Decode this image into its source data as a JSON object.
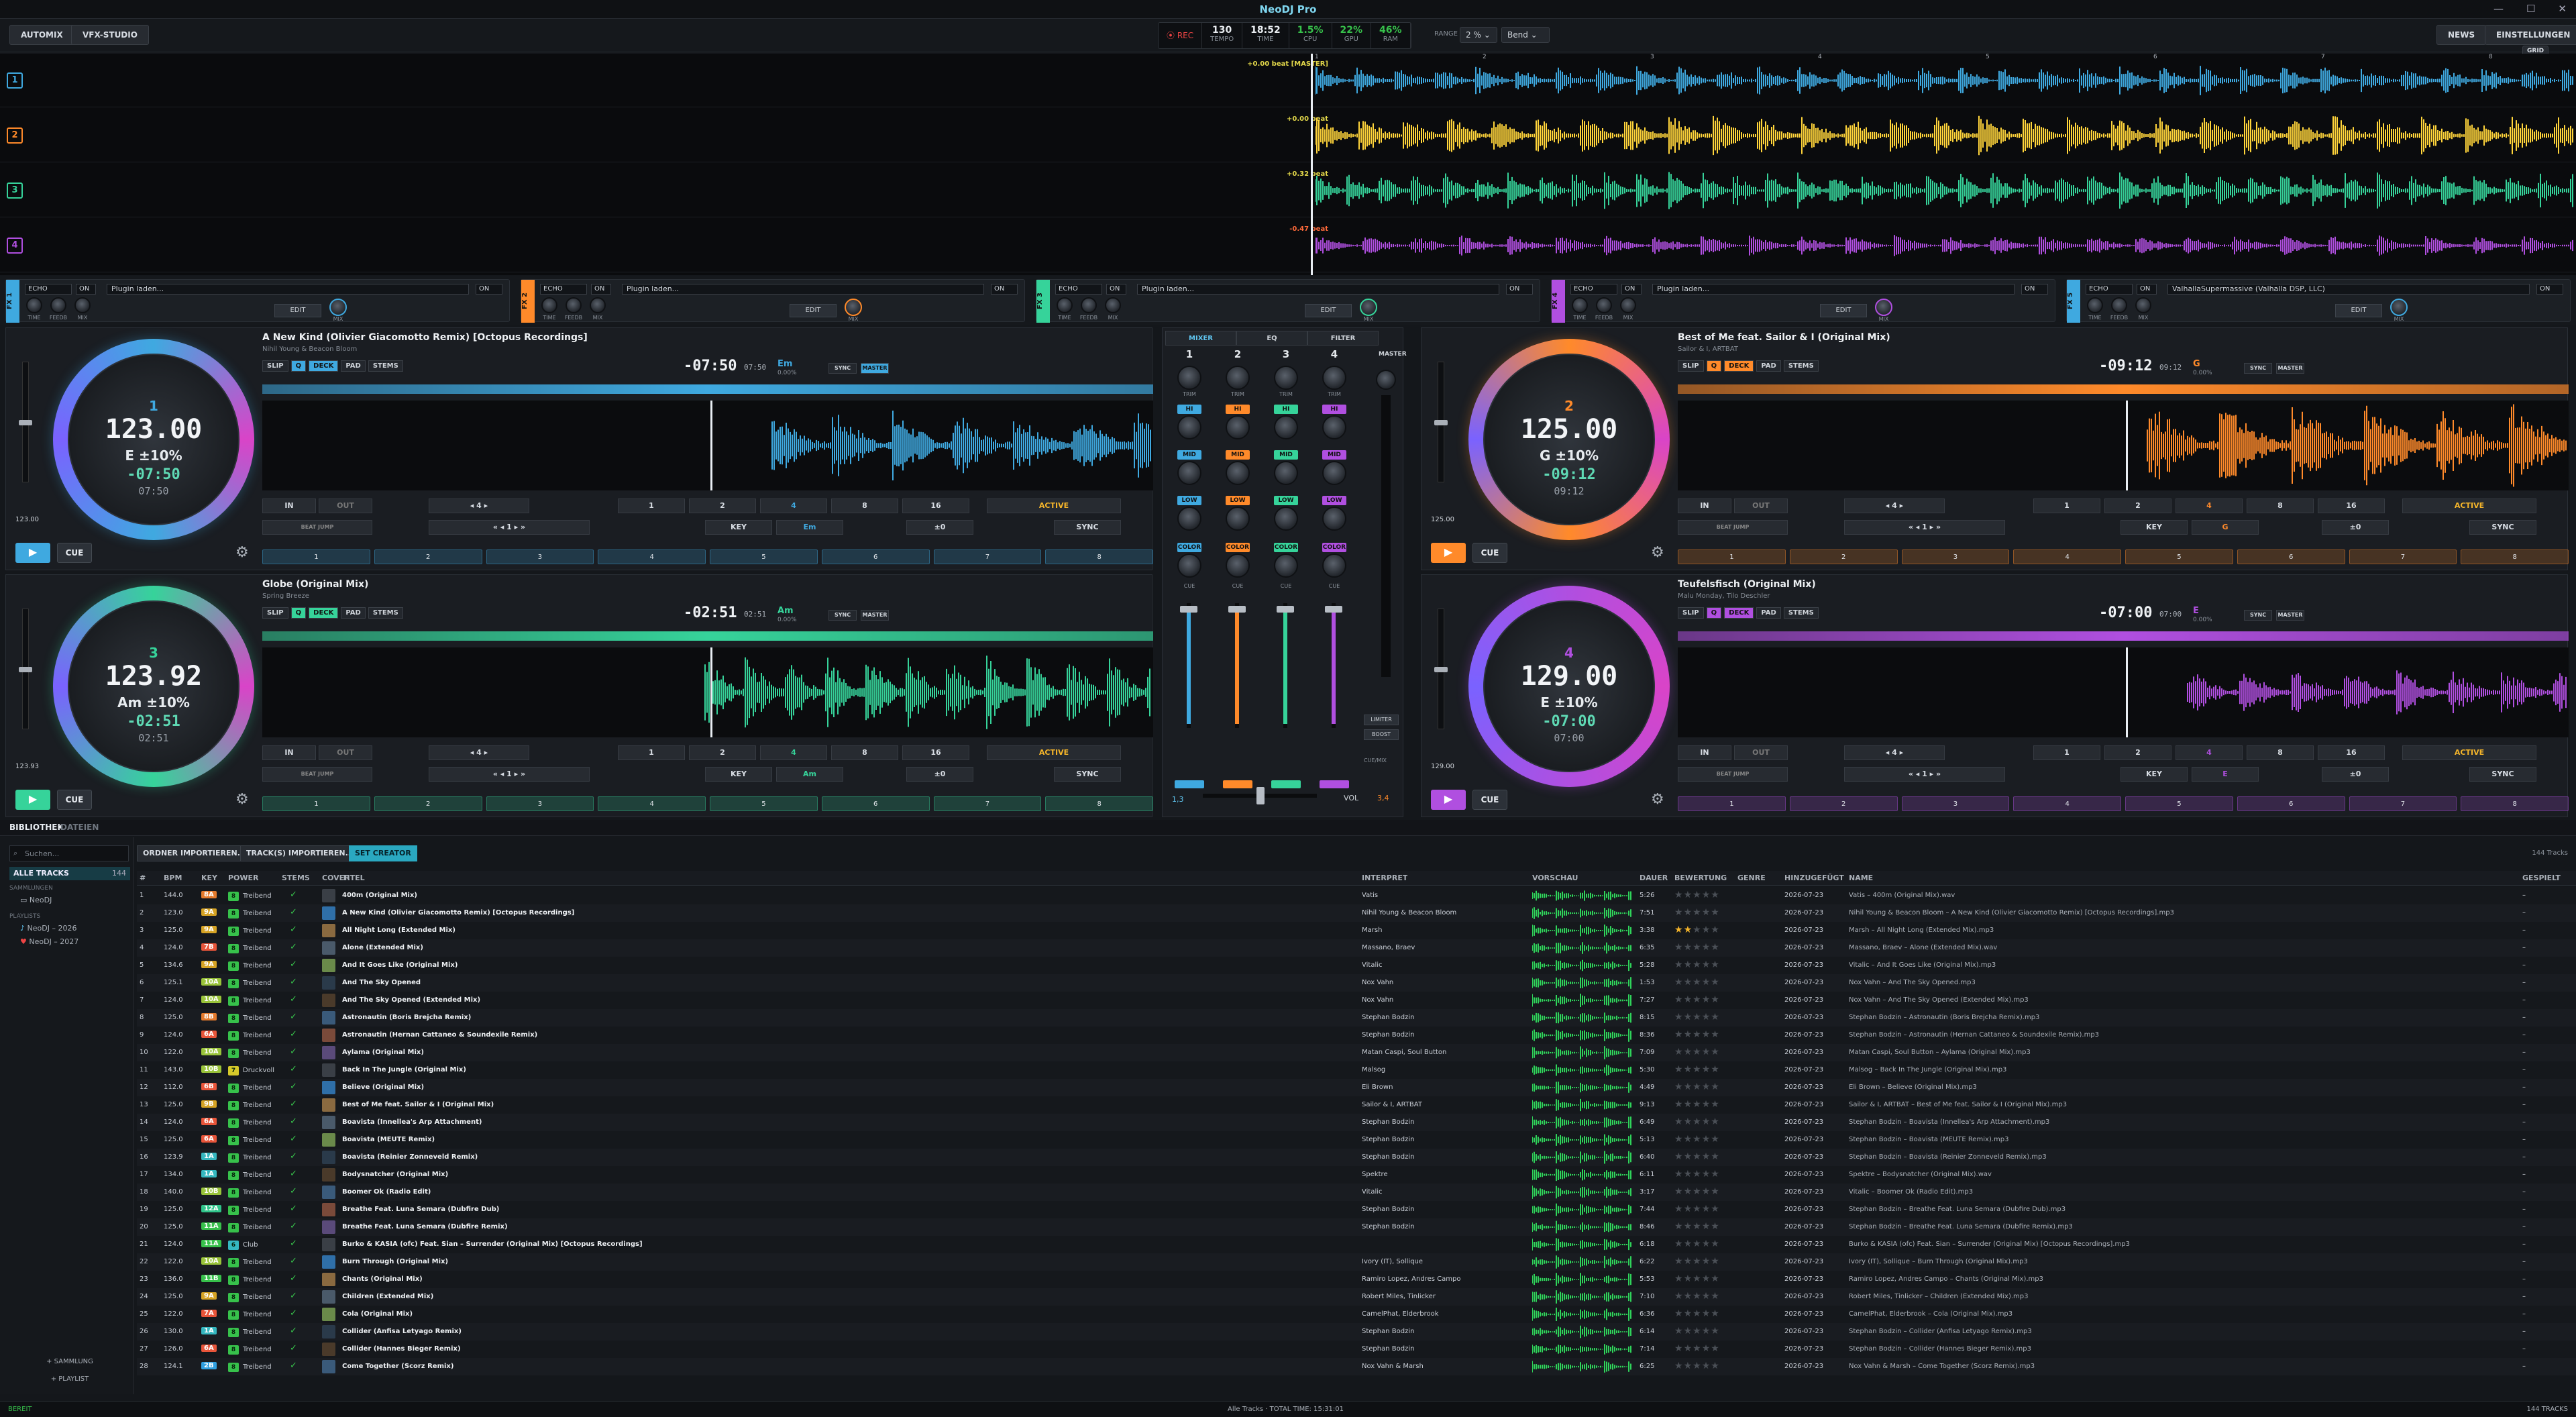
{
  "app": {
    "title": "NeoDJ Pro"
  },
  "toolbar": {
    "automix": "AUTOMIX",
    "vfx": "VFX-STUDIO",
    "rec": "REC",
    "counters": [
      {
        "value": "130",
        "label": "TEMPO"
      },
      {
        "value": "18:52",
        "label": "TIME"
      },
      {
        "value": "1.5%",
        "label": "CPU"
      },
      {
        "value": "22%",
        "label": "GPU"
      },
      {
        "value": "46%",
        "label": "RAM"
      }
    ],
    "range_label": "RANGE",
    "range_value": "2 %",
    "bend_value": "Bend",
    "news": "NEWS",
    "settings": "EINSTELLUNGEN",
    "grid": "GRID"
  },
  "overview": {
    "rows": [
      {
        "num": "1",
        "label": "+0.00 beat [MASTER]",
        "color": "#3fa9e0"
      },
      {
        "num": "2",
        "label": "+0.00 beat",
        "color": "#ff8a2a"
      },
      {
        "num": "3",
        "label": "+0.32 beat",
        "color": "#36d39a"
      },
      {
        "num": "4",
        "label": "-0.47 beat",
        "color": "#b04fe0"
      }
    ],
    "timeline": [
      "1",
      "2",
      "3",
      "4",
      "5",
      "6",
      "7",
      "8"
    ]
  },
  "fx": [
    {
      "tag": "FX 1",
      "color": "#3fa9e0",
      "effect": "ECHO",
      "plugin": "Plugin laden...",
      "edit": "EDIT",
      "knobs": [
        "TIME",
        "FEEDB",
        "MIX"
      ],
      "mix": "MIX",
      "onoff": "ON"
    },
    {
      "tag": "FX 2",
      "color": "#ff8a2a",
      "effect": "ECHO",
      "plugin": "Plugin laden...",
      "edit": "EDIT",
      "knobs": [
        "TIME",
        "FEEDB",
        "MIX"
      ],
      "mix": "MIX",
      "onoff": "ON"
    },
    {
      "tag": "FX 3",
      "color": "#36d39a",
      "effect": "ECHO",
      "plugin": "Plugin laden...",
      "edit": "EDIT",
      "knobs": [
        "TIME",
        "FEEDB",
        "MIX"
      ],
      "mix": "MIX",
      "onoff": "ON"
    },
    {
      "tag": "FX 4",
      "color": "#b04fe0",
      "effect": "ECHO",
      "plugin": "Plugin laden...",
      "edit": "EDIT",
      "knobs": [
        "TIME",
        "FEEDB",
        "MIX"
      ],
      "mix": "MIX",
      "onoff": "ON"
    },
    {
      "tag": "FX 5",
      "color": "#3fa9e0",
      "effect": "ECHO",
      "plugin": "ValhallaSupermassive (Valhalla DSP, LLC)",
      "edit": "EDIT",
      "knobs": [
        "TIME",
        "FEEDB",
        "MIX"
      ],
      "mix": "MIX",
      "onoff": "ON"
    }
  ],
  "decks": [
    {
      "num": "1",
      "color": "#3fa9e0",
      "title": "A New Kind (Olivier Giacomotto Remix) [Octopus Recordings]",
      "artist": "Nihil Young & Beacon Bloom",
      "bpm": "123.00",
      "key": "E",
      "pitch": "±10%",
      "remain": "-07:50",
      "elapsed": "07:50",
      "time_big": "-07:50",
      "time_total": "07:50",
      "key_disp": "Em",
      "key_sub": "0.00%",
      "pitch_value": "123.00",
      "sync": "SYNC",
      "master": "MASTER",
      "in": "IN",
      "out": "OUT",
      "loop": "4",
      "loop_sizes": [
        "1",
        "2",
        "4",
        "8",
        "16"
      ],
      "active": "ACTIVE",
      "beatjump": "BEAT JUMP",
      "jump": "1",
      "keybtn": "KEY",
      "keyval": "Em",
      "pitchval": "±0",
      "syncbtn": "SYNC",
      "pads": [
        "1",
        "2",
        "3",
        "4",
        "5",
        "6",
        "7",
        "8"
      ],
      "play": "▶",
      "cue": "CUE"
    },
    {
      "num": "2",
      "color": "#ff8a2a",
      "title": "Best of Me feat. Sailor & I (Original Mix)",
      "artist": "Sailor & I, ARTBAT",
      "bpm": "125.00",
      "key": "G",
      "pitch": "±10%",
      "remain": "-09:12",
      "elapsed": "09:12",
      "time_big": "-09:12",
      "time_total": "09:12",
      "key_disp": "G",
      "key_sub": "0.00%",
      "pitch_value": "125.00",
      "sync": "SYNC",
      "master": "MASTER",
      "in": "IN",
      "out": "OUT",
      "loop": "4",
      "loop_sizes": [
        "1",
        "2",
        "4",
        "8",
        "16"
      ],
      "active": "ACTIVE",
      "beatjump": "BEAT JUMP",
      "jump": "1",
      "keybtn": "KEY",
      "keyval": "G",
      "pitchval": "±0",
      "syncbtn": "SYNC",
      "pads": [
        "1",
        "2",
        "3",
        "4",
        "5",
        "6",
        "7",
        "8"
      ],
      "play": "▶",
      "cue": "CUE"
    },
    {
      "num": "3",
      "color": "#36d39a",
      "title": "Globe (Original Mix)",
      "artist": "Spring Breeze",
      "bpm": "123.92",
      "key": "Am",
      "pitch": "±10%",
      "remain": "-02:51",
      "elapsed": "02:51",
      "time_big": "-02:51",
      "time_total": "02:51",
      "key_disp": "Am",
      "key_sub": "0.00%",
      "pitch_value": "123.93",
      "sync": "SYNC",
      "master": "MASTER",
      "in": "IN",
      "out": "OUT",
      "loop": "4",
      "loop_sizes": [
        "1",
        "2",
        "4",
        "8",
        "16"
      ],
      "active": "ACTIVE",
      "beatjump": "BEAT JUMP",
      "jump": "1",
      "keybtn": "KEY",
      "keyval": "Am",
      "pitchval": "±0",
      "syncbtn": "SYNC",
      "pads": [
        "1",
        "2",
        "3",
        "4",
        "5",
        "6",
        "7",
        "8"
      ],
      "play": "▶",
      "cue": "CUE"
    },
    {
      "num": "4",
      "color": "#b04fe0",
      "title": "Teufelsfisch (Original Mix)",
      "artist": "Malu Monday, Tilo Deschler",
      "bpm": "129.00",
      "key": "E",
      "pitch": "±10%",
      "remain": "-07:00",
      "elapsed": "07:00",
      "time_big": "-07:00",
      "time_total": "07:00",
      "key_disp": "E",
      "key_sub": "0.00%",
      "pitch_value": "129.00",
      "sync": "SYNC",
      "master": "MASTER",
      "in": "IN",
      "out": "OUT",
      "loop": "4",
      "loop_sizes": [
        "1",
        "2",
        "4",
        "8",
        "16"
      ],
      "active": "ACTIVE",
      "beatjump": "BEAT JUMP",
      "jump": "1",
      "keybtn": "KEY",
      "keyval": "E",
      "pitchval": "±0",
      "syncbtn": "SYNC",
      "pads": [
        "1",
        "2",
        "3",
        "4",
        "5",
        "6",
        "7",
        "8"
      ],
      "play": "▶",
      "cue": "CUE"
    }
  ],
  "deck_modes": [
    "SLIP",
    "Q",
    "DECK",
    "PAD",
    "STEMS"
  ],
  "mixer": {
    "tabs": [
      "MIXER",
      "EQ",
      "FILTER"
    ],
    "master": "MASTER",
    "channels": [
      "1",
      "2",
      "3",
      "4"
    ],
    "trim": "TRIM",
    "eq": [
      "HI",
      "MID",
      "LOW"
    ],
    "color": "COLOR",
    "cue": "CUE",
    "limiter": "LIMITER",
    "boost": "BOOST",
    "xfader_value": "1,3",
    "vol_label": "VOL",
    "vol_value": "3,4",
    "headphones": "CUE/MIX"
  },
  "library": {
    "tabs": [
      "BIBLIOTHEK",
      "DATEIEN"
    ],
    "search_placeholder": "Suchen...",
    "sidebar": [
      "ALLE TRACKS",
      "SAMMLUNGEN",
      "NeoDJ",
      "PLAYLISTS",
      "NeoDJ – 2026",
      "NeoDJ – 2027"
    ],
    "all_count": "144",
    "add_collection": "+ SAMMLUNG",
    "add_playlist": "+ PLAYLIST",
    "buttons": [
      "ORDNER IMPORTIEREN...",
      "TRACK(S) IMPORTIEREN...",
      "SET CREATOR"
    ],
    "count": "144 Tracks",
    "columns": [
      "#",
      "BPM",
      "KEY",
      "POWER",
      "STEMS",
      "COVER",
      "TITEL",
      "INTERPRET",
      "VORSCHAU",
      "DAUER",
      "BEWERTUNG",
      "GENRE",
      "HINZUGEFÜGT",
      "NAME",
      "GESPIELT"
    ],
    "rows": [
      {
        "n": "1",
        "bpm": "144.0",
        "key": "8A",
        "power": "8",
        "genre_p": "Treibend",
        "title": "400m (Original Mix)",
        "artist": "Vatis",
        "dur": "5:26",
        "stars": 0,
        "added": "2026-07-23",
        "name": "Vatis – 400m (Original Mix).wav",
        "played": "–"
      },
      {
        "n": "2",
        "bpm": "123.0",
        "key": "9A",
        "power": "8",
        "genre_p": "Treibend",
        "title": "A New Kind (Olivier Giacomotto Remix) [Octopus Recordings]",
        "artist": "Nihil Young & Beacon Bloom",
        "dur": "7:51",
        "stars": 0,
        "added": "2026-07-23",
        "name": "Nihil Young & Beacon Bloom – A New Kind (Olivier Giacomotto Remix) [Octopus Recordings].mp3",
        "played": "–"
      },
      {
        "n": "3",
        "bpm": "125.0",
        "key": "9A",
        "power": "8",
        "genre_p": "Treibend",
        "title": "All Night Long (Extended Mix)",
        "artist": "Marsh",
        "dur": "3:38",
        "stars": 2,
        "added": "2026-07-23",
        "name": "Marsh – All Night Long (Extended Mix).mp3",
        "played": "–"
      },
      {
        "n": "4",
        "bpm": "124.0",
        "key": "7B",
        "power": "8",
        "genre_p": "Treibend",
        "title": "Alone (Extended Mix)",
        "artist": "Massano, Braev",
        "dur": "6:35",
        "stars": 0,
        "added": "2026-07-23",
        "name": "Massano, Braev – Alone (Extended Mix).wav",
        "played": "–"
      },
      {
        "n": "5",
        "bpm": "134.6",
        "key": "9A",
        "power": "8",
        "genre_p": "Treibend",
        "title": "And It Goes Like (Original Mix)",
        "artist": "Vitalic",
        "dur": "5:28",
        "stars": 0,
        "added": "2026-07-23",
        "name": "Vitalic – And It Goes Like (Original Mix).mp3",
        "played": "–"
      },
      {
        "n": "6",
        "bpm": "125.1",
        "key": "10A",
        "power": "8",
        "genre_p": "Treibend",
        "title": "And The Sky Opened",
        "artist": "Nox Vahn",
        "dur": "1:53",
        "stars": 0,
        "added": "2026-07-23",
        "name": "Nox Vahn – And The Sky Opened.mp3",
        "played": "–"
      },
      {
        "n": "7",
        "bpm": "124.0",
        "key": "10A",
        "power": "8",
        "genre_p": "Treibend",
        "title": "And The Sky Opened (Extended Mix)",
        "artist": "Nox Vahn",
        "dur": "7:27",
        "stars": 0,
        "added": "2026-07-23",
        "name": "Nox Vahn – And The Sky Opened (Extended Mix).mp3",
        "played": "–"
      },
      {
        "n": "8",
        "bpm": "125.0",
        "key": "8B",
        "power": "8",
        "genre_p": "Treibend",
        "title": "Astronautin (Boris Brejcha Remix)",
        "artist": "Stephan Bodzin",
        "dur": "8:15",
        "stars": 0,
        "added": "2026-07-23",
        "name": "Stephan Bodzin – Astronautin (Boris Brejcha Remix).mp3",
        "played": "–"
      },
      {
        "n": "9",
        "bpm": "124.0",
        "key": "6A",
        "power": "8",
        "genre_p": "Treibend",
        "title": "Astronautin (Hernan Cattaneo & Soundexile Remix)",
        "artist": "Stephan Bodzin",
        "dur": "8:36",
        "stars": 0,
        "added": "2026-07-23",
        "name": "Stephan Bodzin – Astronautin (Hernan Cattaneo & Soundexile Remix).mp3",
        "played": "–"
      },
      {
        "n": "10",
        "bpm": "122.0",
        "key": "10A",
        "power": "8",
        "genre_p": "Treibend",
        "title": "Aylama (Original Mix)",
        "artist": "Matan Caspi, Soul Button",
        "dur": "7:09",
        "stars": 0,
        "added": "2026-07-23",
        "name": "Matan Caspi, Soul Button – Aylama (Original Mix).mp3",
        "played": "–"
      },
      {
        "n": "11",
        "bpm": "143.0",
        "key": "10B",
        "power": "7",
        "genre_p": "Druckvoll",
        "title": "Back In The Jungle (Original Mix)",
        "artist": "Malsog",
        "dur": "5:30",
        "stars": 0,
        "added": "2026-07-23",
        "name": "Malsog – Back In The Jungle (Original Mix).mp3",
        "played": "–"
      },
      {
        "n": "12",
        "bpm": "112.0",
        "key": "6B",
        "power": "8",
        "genre_p": "Treibend",
        "title": "Believe (Original Mix)",
        "artist": "Eli Brown",
        "dur": "4:49",
        "stars": 0,
        "added": "2026-07-23",
        "name": "Eli Brown – Believe (Original Mix).mp3",
        "played": "–"
      },
      {
        "n": "13",
        "bpm": "125.0",
        "key": "9B",
        "power": "8",
        "genre_p": "Treibend",
        "title": "Best of Me feat. Sailor & I (Original Mix)",
        "artist": "Sailor & I, ARTBAT",
        "dur": "9:13",
        "stars": 0,
        "added": "2026-07-23",
        "name": "Sailor & I, ARTBAT – Best of Me feat. Sailor & I (Original Mix).mp3",
        "played": "–"
      },
      {
        "n": "14",
        "bpm": "124.0",
        "key": "6A",
        "power": "8",
        "genre_p": "Treibend",
        "title": "Boavista (Innellea's Arp Attachment)",
        "artist": "Stephan Bodzin",
        "dur": "6:49",
        "stars": 0,
        "added": "2026-07-23",
        "name": "Stephan Bodzin – Boavista (Innellea's Arp Attachment).mp3",
        "played": "–"
      },
      {
        "n": "15",
        "bpm": "125.0",
        "key": "6A",
        "power": "8",
        "genre_p": "Treibend",
        "title": "Boavista (MEUTE Remix)",
        "artist": "Stephan Bodzin",
        "dur": "5:13",
        "stars": 0,
        "added": "2026-07-23",
        "name": "Stephan Bodzin – Boavista (MEUTE Remix).mp3",
        "played": "–"
      },
      {
        "n": "16",
        "bpm": "123.9",
        "key": "1A",
        "power": "8",
        "genre_p": "Treibend",
        "title": "Boavista (Reinier Zonneveld Remix)",
        "artist": "Stephan Bodzin",
        "dur": "6:40",
        "stars": 0,
        "added": "2026-07-23",
        "name": "Stephan Bodzin – Boavista (Reinier Zonneveld Remix).mp3",
        "played": "–"
      },
      {
        "n": "17",
        "bpm": "134.0",
        "key": "1A",
        "power": "8",
        "genre_p": "Treibend",
        "title": "Bodysnatcher (Original Mix)",
        "artist": "Spektre",
        "dur": "6:11",
        "stars": 0,
        "added": "2026-07-23",
        "name": "Spektre – Bodysnatcher (Original Mix).wav",
        "played": "–"
      },
      {
        "n": "18",
        "bpm": "140.0",
        "key": "10B",
        "power": "8",
        "genre_p": "Treibend",
        "title": "Boomer Ok (Radio Edit)",
        "artist": "Vitalic",
        "dur": "3:17",
        "stars": 0,
        "added": "2026-07-23",
        "name": "Vitalic – Boomer Ok (Radio Edit).mp3",
        "played": "–"
      },
      {
        "n": "19",
        "bpm": "125.0",
        "key": "12A",
        "power": "8",
        "genre_p": "Treibend",
        "title": "Breathe Feat. Luna Semara (Dubfire Dub)",
        "artist": "Stephan Bodzin",
        "dur": "7:44",
        "stars": 0,
        "added": "2026-07-23",
        "name": "Stephan Bodzin – Breathe Feat. Luna Semara (Dubfire Dub).mp3",
        "played": "–"
      },
      {
        "n": "20",
        "bpm": "125.0",
        "key": "11A",
        "power": "8",
        "genre_p": "Treibend",
        "title": "Breathe Feat. Luna Semara (Dubfire Remix)",
        "artist": "Stephan Bodzin",
        "dur": "8:46",
        "stars": 0,
        "added": "2026-07-23",
        "name": "Stephan Bodzin – Breathe Feat. Luna Semara (Dubfire Remix).mp3",
        "played": "–"
      },
      {
        "n": "21",
        "bpm": "124.0",
        "key": "11A",
        "power": "6",
        "genre_p": "Club",
        "title": "Burko & KASIA (ofc) Feat. Sian – Surrender (Original Mix) [Octopus Recordings]",
        "artist": "",
        "dur": "6:18",
        "stars": 0,
        "added": "2026-07-23",
        "name": "Burko & KASIA (ofc) Feat. Sian – Surrender (Original Mix) [Octopus Recordings].mp3",
        "played": "–"
      },
      {
        "n": "22",
        "bpm": "122.0",
        "key": "10A",
        "power": "8",
        "genre_p": "Treibend",
        "title": "Burn Through (Original Mix)",
        "artist": "Ivory (IT), Sollique",
        "dur": "6:22",
        "stars": 0,
        "added": "2026-07-23",
        "name": "Ivory (IT), Sollique – Burn Through (Original Mix).mp3",
        "played": "–"
      },
      {
        "n": "23",
        "bpm": "136.0",
        "key": "11B",
        "power": "8",
        "genre_p": "Treibend",
        "title": "Chants (Original Mix)",
        "artist": "Ramiro Lopez, Andres Campo",
        "dur": "5:53",
        "stars": 0,
        "added": "2026-07-23",
        "name": "Ramiro Lopez, Andres Campo – Chants (Original Mix).mp3",
        "played": "–"
      },
      {
        "n": "24",
        "bpm": "125.0",
        "key": "9A",
        "power": "8",
        "genre_p": "Treibend",
        "title": "Children (Extended Mix)",
        "artist": "Robert Miles, Tinlicker",
        "dur": "7:10",
        "stars": 0,
        "added": "2026-07-23",
        "name": "Robert Miles, Tinlicker – Children (Extended Mix).mp3",
        "played": "–"
      },
      {
        "n": "25",
        "bpm": "122.0",
        "key": "7A",
        "power": "8",
        "genre_p": "Treibend",
        "title": "Cola (Original Mix)",
        "artist": "CamelPhat, Elderbrook",
        "dur": "6:36",
        "stars": 0,
        "added": "2026-07-23",
        "name": "CamelPhat, Elderbrook – Cola (Original Mix).mp3",
        "played": "–"
      },
      {
        "n": "26",
        "bpm": "130.0",
        "key": "1A",
        "power": "8",
        "genre_p": "Treibend",
        "title": "Collider (Anfisa Letyago Remix)",
        "artist": "Stephan Bodzin",
        "dur": "6:14",
        "stars": 0,
        "added": "2026-07-23",
        "name": "Stephan Bodzin – Collider (Anfisa Letyago Remix).mp3",
        "played": "–"
      },
      {
        "n": "27",
        "bpm": "126.0",
        "key": "6A",
        "power": "8",
        "genre_p": "Treibend",
        "title": "Collider (Hannes Bieger Remix)",
        "artist": "Stephan Bodzin",
        "dur": "7:14",
        "stars": 0,
        "added": "2026-07-23",
        "name": "Stephan Bodzin – Collider (Hannes Bieger Remix).mp3",
        "played": "–"
      },
      {
        "n": "28",
        "bpm": "124.1",
        "key": "2B",
        "power": "8",
        "genre_p": "Treibend",
        "title": "Come Together (Scorz Remix)",
        "artist": "Nox Vahn & Marsh",
        "dur": "6:25",
        "stars": 0,
        "added": "2026-07-23",
        "name": "Nox Vahn & Marsh – Come Together (Scorz Remix).mp3",
        "played": "–"
      }
    ]
  },
  "statusbar": {
    "left": "BEREIT",
    "center": "Alle Tracks · TOTAL TIME: 15:31:01",
    "right": "144 TRACKS"
  }
}
